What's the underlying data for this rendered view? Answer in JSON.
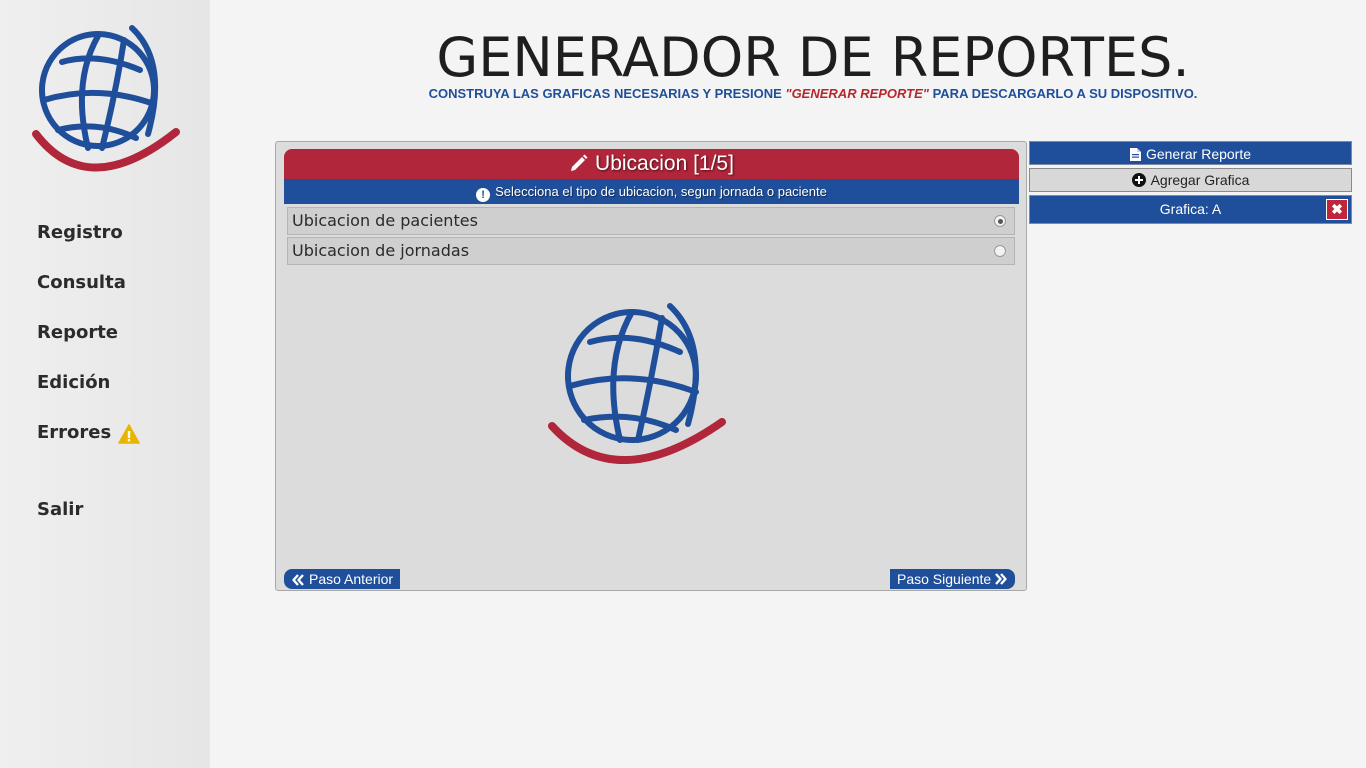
{
  "header": {
    "title": "GENERADOR DE REPORTES.",
    "subtitle_pre": "CONSTRUYA LAS GRAFICAS NECESARIAS Y PRESIONE ",
    "subtitle_em": "\"GENERAR REPORTE\"",
    "subtitle_post": " PARA DESCARGARLO A SU DISPOSITIVO."
  },
  "sidebar": {
    "logo_icon": "globe-logo-icon",
    "items": [
      {
        "label": "Registro"
      },
      {
        "label": "Consulta"
      },
      {
        "label": "Reporte"
      },
      {
        "label": "Edición"
      },
      {
        "label": "Errores",
        "icon": "warning-icon"
      },
      {
        "label": "Salir"
      }
    ]
  },
  "panel": {
    "title": "Ubicacion [1/5]",
    "title_icon": "pencil-icon",
    "instruction": "Selecciona el tipo de ubicacion, segun jornada o paciente",
    "instruction_icon": "exclamation-icon",
    "options": [
      {
        "label": "Ubicacion de pacientes",
        "selected": true
      },
      {
        "label": "Ubicacion de jornadas",
        "selected": false
      }
    ],
    "prev_label": "Paso Anterior",
    "next_label": "Paso Siguiente"
  },
  "actions": {
    "generate_label": "Generar Reporte",
    "generate_icon": "document-icon",
    "add_label": "Agregar Grafica",
    "add_icon": "plus-circle-icon",
    "chart_item_label": "Grafica: A",
    "remove_icon": "close-icon"
  },
  "colors": {
    "brand_blue": "#1f4f9a",
    "brand_red": "#b1263a",
    "warning": "#e8b400"
  }
}
